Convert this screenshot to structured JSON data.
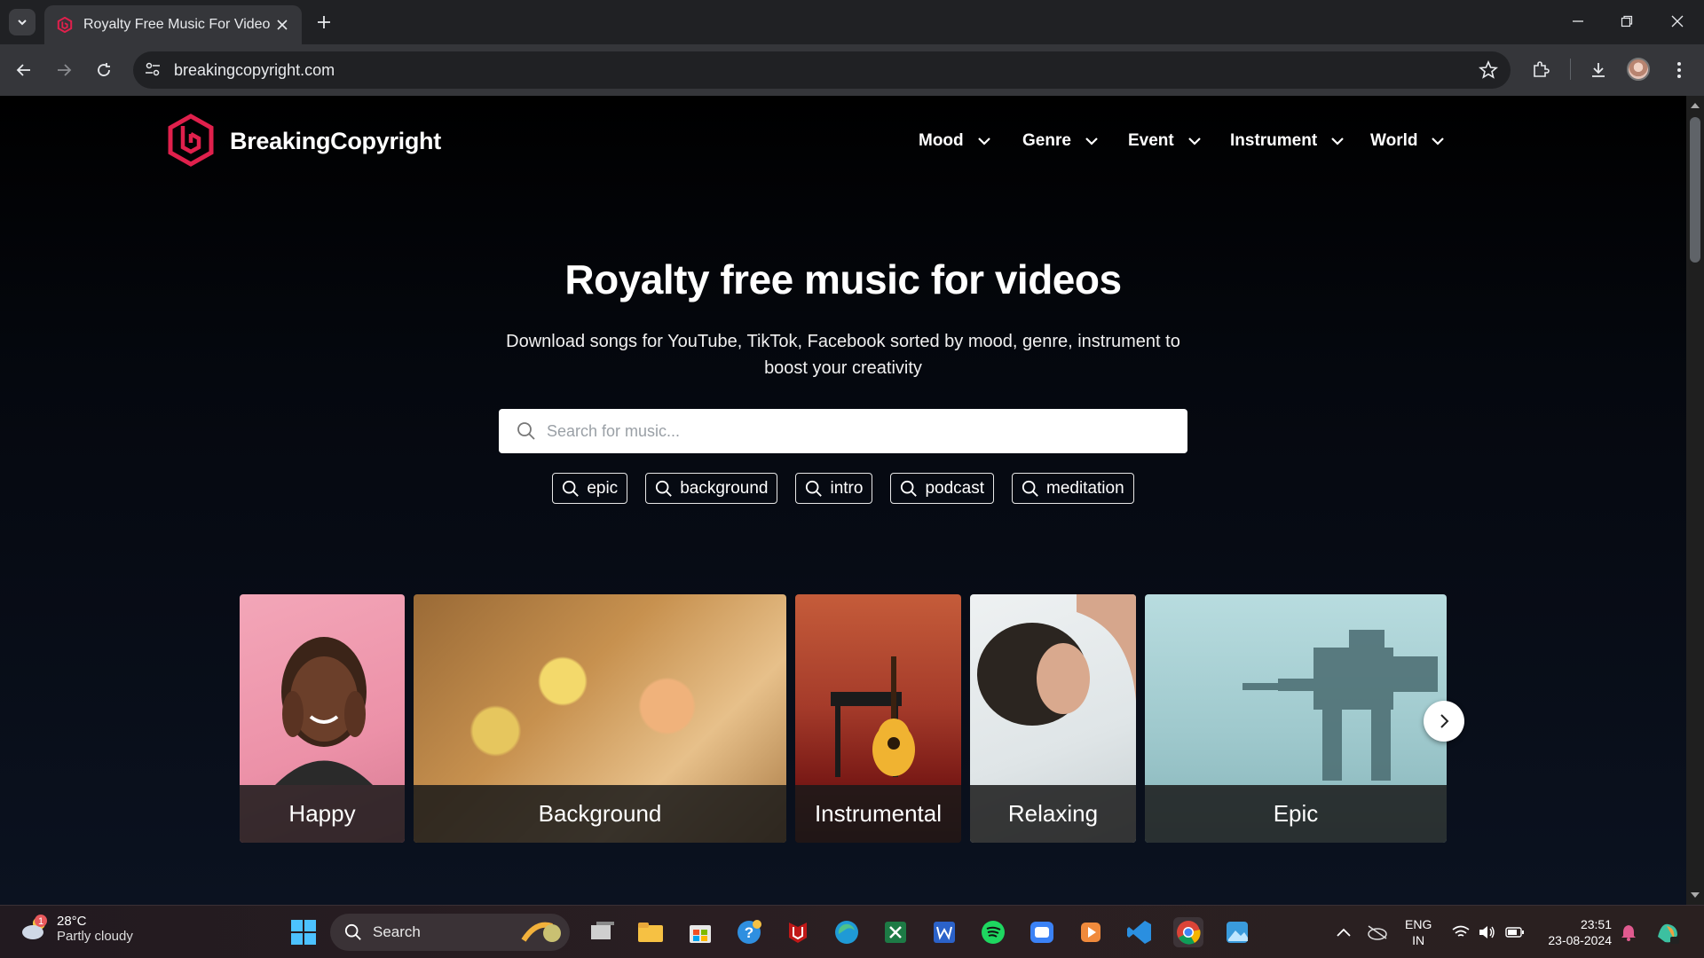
{
  "browser": {
    "tab_title": "Royalty Free Music For Videos -",
    "url": "breakingcopyright.com"
  },
  "site": {
    "brand": "BreakingCopyright",
    "nav": [
      {
        "label": "Mood"
      },
      {
        "label": "Genre"
      },
      {
        "label": "Event"
      },
      {
        "label": "Instrument"
      },
      {
        "label": "World"
      }
    ],
    "hero_title": "Royalty free music for videos",
    "hero_subtitle": "Download songs for YouTube, TikTok, Facebook sorted by mood, genre, instrument to boost your creativity",
    "search_placeholder": "Search for music...",
    "tags": [
      "epic",
      "background",
      "intro",
      "podcast",
      "meditation"
    ],
    "categories": [
      "Happy",
      "Background",
      "Instrumental",
      "Relaxing",
      "Epic"
    ]
  },
  "taskbar": {
    "weather_temp": "28°C",
    "weather_condition": "Partly cloudy",
    "weather_badge": "1",
    "search_label": "Search",
    "lang_line1": "ENG",
    "lang_line2": "IN",
    "time": "23:51",
    "date": "23-08-2024"
  },
  "colors": {
    "brand_red": "#e0204c",
    "page_bg": "#000000",
    "chrome_dark": "#202124",
    "chrome_toolbar": "#35363a"
  }
}
